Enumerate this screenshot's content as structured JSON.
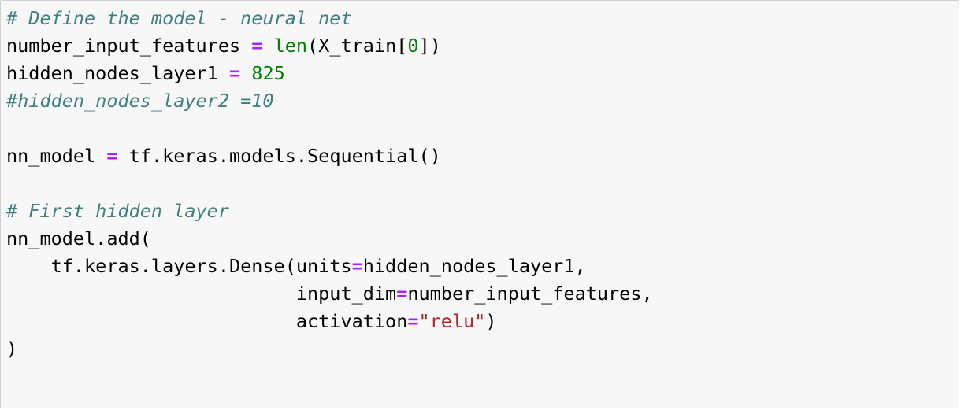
{
  "cell": {
    "lines": [
      {
        "comment": "# Define the model - neural net"
      },
      {
        "var": "number_input_features",
        "op": "=",
        "builtin": "len",
        "open": "(X_train[",
        "num": "0",
        "close": "])"
      },
      {
        "var": "hidden_nodes_layer1",
        "op": "=",
        "num": "825"
      },
      {
        "comment": "#hidden_nodes_layer2 =10"
      },
      {},
      {
        "var": "nn_model",
        "op": "=",
        "rest": "tf.keras.models.Sequential()"
      },
      {},
      {
        "comment": "# First hidden layer"
      },
      {
        "text": "nn_model.add("
      },
      {
        "indent": "    ",
        "text": "tf.keras.layers.Dense(units",
        "op": "=",
        "after": "hidden_nodes_layer1,"
      },
      {
        "indent": "                          ",
        "text": "input_dim",
        "op": "=",
        "after": "number_input_features,"
      },
      {
        "indent": "                          ",
        "text": "activation",
        "op": "=",
        "str": "\"relu\"",
        "after": ")"
      },
      {
        "text": ")"
      }
    ]
  },
  "colors": {
    "background": "#f7f7f7",
    "border": "#cfcfcf",
    "comment": "#408080",
    "operator": "#aa22ff",
    "number": "#008000",
    "builtin": "#008000",
    "string": "#ba2121"
  }
}
